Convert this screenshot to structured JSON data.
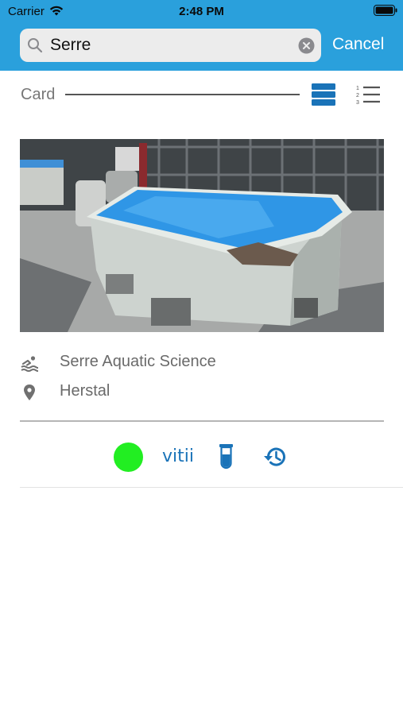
{
  "status_bar": {
    "carrier": "Carrier",
    "time": "2:48 PM"
  },
  "search": {
    "value": "Serre",
    "cancel_label": "Cancel"
  },
  "view_toggle": {
    "label": "Card",
    "active_view": "card"
  },
  "card": {
    "photo_description_icon": "pool-photo",
    "name": "Serre Aquatic Science",
    "location": "Herstal",
    "status_color": "#22ee22",
    "link_label": "vitii"
  },
  "colors": {
    "header_bg": "#2aa0dc",
    "accent": "#1a73b8",
    "status_ok": "#22ee22"
  },
  "icons": {
    "search": "search-icon",
    "clear": "clear-icon",
    "card_view": "card-view-icon",
    "list_view": "numbered-list-icon",
    "name": "swimmer-icon",
    "location": "location-pin-icon",
    "tests": "test-tube-icon",
    "history": "history-icon"
  }
}
